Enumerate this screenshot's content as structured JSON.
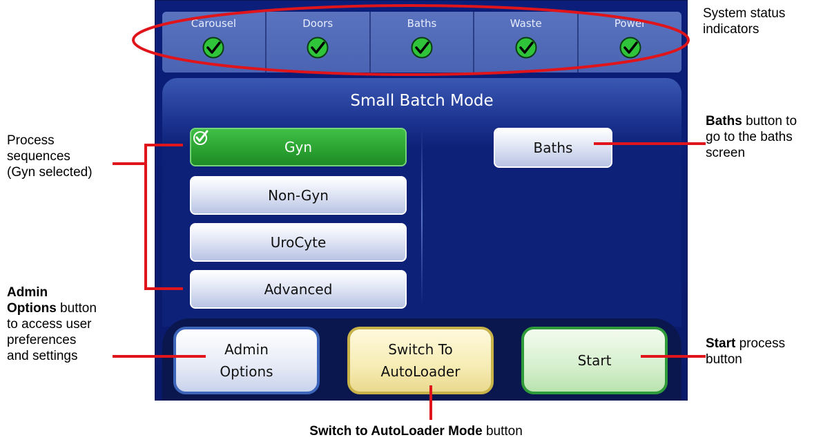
{
  "status_bar": {
    "items": [
      {
        "label": "Carousel",
        "icon": "check-circle-icon",
        "status_color": "#2fc43a"
      },
      {
        "label": "Doors",
        "icon": "check-circle-icon",
        "status_color": "#2fc43a"
      },
      {
        "label": "Baths",
        "icon": "check-circle-icon",
        "status_color": "#2fc43a"
      },
      {
        "label": "Waste",
        "icon": "check-circle-icon",
        "status_color": "#2fc43a"
      },
      {
        "label": "Power",
        "icon": "check-circle-icon",
        "status_color": "#2fc43a"
      }
    ]
  },
  "mode": {
    "title": "Small Batch Mode"
  },
  "sequences": [
    {
      "label": "Gyn",
      "selected": true
    },
    {
      "label": "Non-Gyn",
      "selected": false
    },
    {
      "label": "UroCyte",
      "selected": false
    },
    {
      "label": "Advanced",
      "selected": false
    }
  ],
  "baths_button": {
    "label": "Baths"
  },
  "bottom_buttons": {
    "admin": {
      "line1": "Admin",
      "line2": "Options"
    },
    "switch": {
      "line1": "Switch To",
      "line2": "AutoLoader"
    },
    "start": {
      "label": "Start"
    }
  },
  "annotations": {
    "system_status": {
      "line1": "System status",
      "line2": "indicators"
    },
    "process_sequences": {
      "line1": "Process",
      "line2": "sequences",
      "line3": "(Gyn selected)"
    },
    "baths": {
      "bold": "Baths",
      "line1_rest": " button to",
      "line2": "go to the baths",
      "line3": "screen"
    },
    "admin": {
      "bold1": "Admin",
      "bold2": "Options",
      "line2_rest": " button",
      "line3": "to access user",
      "line4": "preferences",
      "line5": "and settings"
    },
    "start": {
      "bold": "Start",
      "line1_rest": " process",
      "line2": "button"
    },
    "switch": {
      "bold": "Switch to AutoLoader Mode",
      "rest": " button"
    }
  },
  "colors": {
    "callout_red": "#e0141b",
    "screen_blue": "#0b1f7a",
    "selected_green": "#2ea634"
  }
}
